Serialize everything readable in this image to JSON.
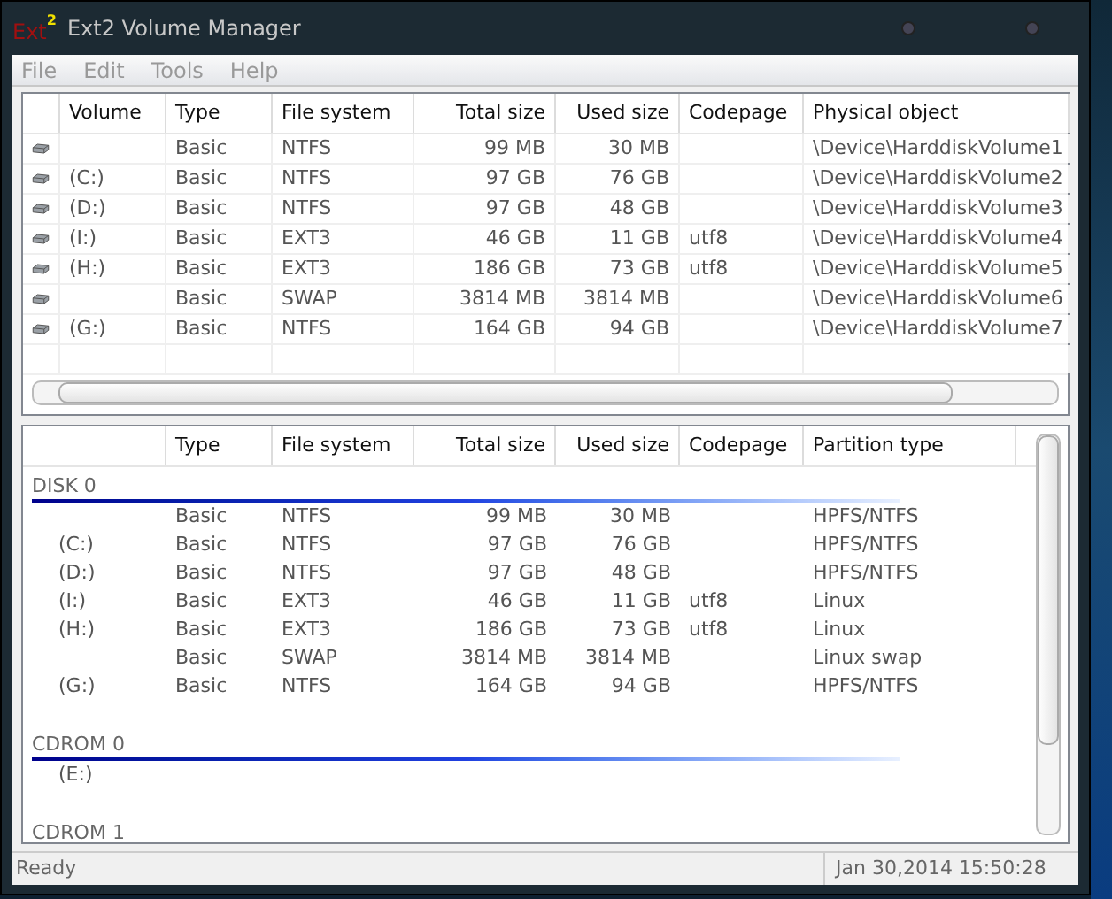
{
  "window": {
    "title": "Ext2 Volume Manager",
    "logo": "Ext",
    "logo_superscript": "2"
  },
  "menu": [
    "File",
    "Edit",
    "Tools",
    "Help"
  ],
  "volumes": {
    "columns": [
      "Volume",
      "Type",
      "File system",
      "Total size",
      "Used size",
      "Codepage",
      "Physical object"
    ],
    "rows": [
      {
        "type": "Basic",
        "file_system": "NTFS",
        "total_size": "99 MB",
        "used_size": "30 MB",
        "physical_object": "\\Device\\HarddiskVolume1"
      },
      {
        "volume": "(C:)",
        "type": "Basic",
        "file_system": "NTFS",
        "total_size": "97 GB",
        "used_size": "76 GB",
        "physical_object": "\\Device\\HarddiskVolume2"
      },
      {
        "volume": "(D:)",
        "type": "Basic",
        "file_system": "NTFS",
        "total_size": "97 GB",
        "used_size": "48 GB",
        "physical_object": "\\Device\\HarddiskVolume3"
      },
      {
        "volume": "(I:)",
        "type": "Basic",
        "file_system": "EXT3",
        "total_size": "46 GB",
        "used_size": "11 GB",
        "codepage": "utf8",
        "physical_object": "\\Device\\HarddiskVolume4"
      },
      {
        "volume": "(H:)",
        "type": "Basic",
        "file_system": "EXT3",
        "total_size": "186 GB",
        "used_size": "73 GB",
        "codepage": "utf8",
        "physical_object": "\\Device\\HarddiskVolume5"
      },
      {
        "type": "Basic",
        "file_system": "SWAP",
        "total_size": "3814 MB",
        "used_size": "3814 MB",
        "physical_object": "\\Device\\HarddiskVolume6"
      },
      {
        "volume": "(G:)",
        "type": "Basic",
        "file_system": "NTFS",
        "total_size": "164 GB",
        "used_size": "94 GB",
        "physical_object": "\\Device\\HarddiskVolume7"
      }
    ]
  },
  "disks": {
    "columns": [
      "Type",
      "File system",
      "Total size",
      "Used size",
      "Codepage",
      "Partition type"
    ],
    "groups": [
      {
        "name": "DISK 0",
        "partitions": [
          {
            "type": "Basic",
            "file_system": "NTFS",
            "total_size": "99 MB",
            "used_size": "30 MB",
            "partition_type": "HPFS/NTFS"
          },
          {
            "volume": "(C:)",
            "type": "Basic",
            "file_system": "NTFS",
            "total_size": "97 GB",
            "used_size": "76 GB",
            "partition_type": "HPFS/NTFS"
          },
          {
            "volume": "(D:)",
            "type": "Basic",
            "file_system": "NTFS",
            "total_size": "97 GB",
            "used_size": "48 GB",
            "partition_type": "HPFS/NTFS"
          },
          {
            "volume": "(I:)",
            "type": "Basic",
            "file_system": "EXT3",
            "total_size": "46 GB",
            "used_size": "11 GB",
            "codepage": "utf8",
            "partition_type": "Linux"
          },
          {
            "volume": "(H:)",
            "type": "Basic",
            "file_system": "EXT3",
            "total_size": "186 GB",
            "used_size": "73 GB",
            "codepage": "utf8",
            "partition_type": "Linux"
          },
          {
            "type": "Basic",
            "file_system": "SWAP",
            "total_size": "3814 MB",
            "used_size": "3814 MB",
            "partition_type": "Linux swap"
          },
          {
            "volume": "(G:)",
            "type": "Basic",
            "file_system": "NTFS",
            "total_size": "164 GB",
            "used_size": "94 GB",
            "partition_type": "HPFS/NTFS"
          }
        ]
      },
      {
        "name": "CDROM 0",
        "partitions": [
          {
            "volume": "(E:)"
          }
        ]
      },
      {
        "name": "CDROM 1"
      }
    ]
  },
  "status_bar": {
    "text": "Ready",
    "time": "Jan 30,2014 15:50:28"
  }
}
